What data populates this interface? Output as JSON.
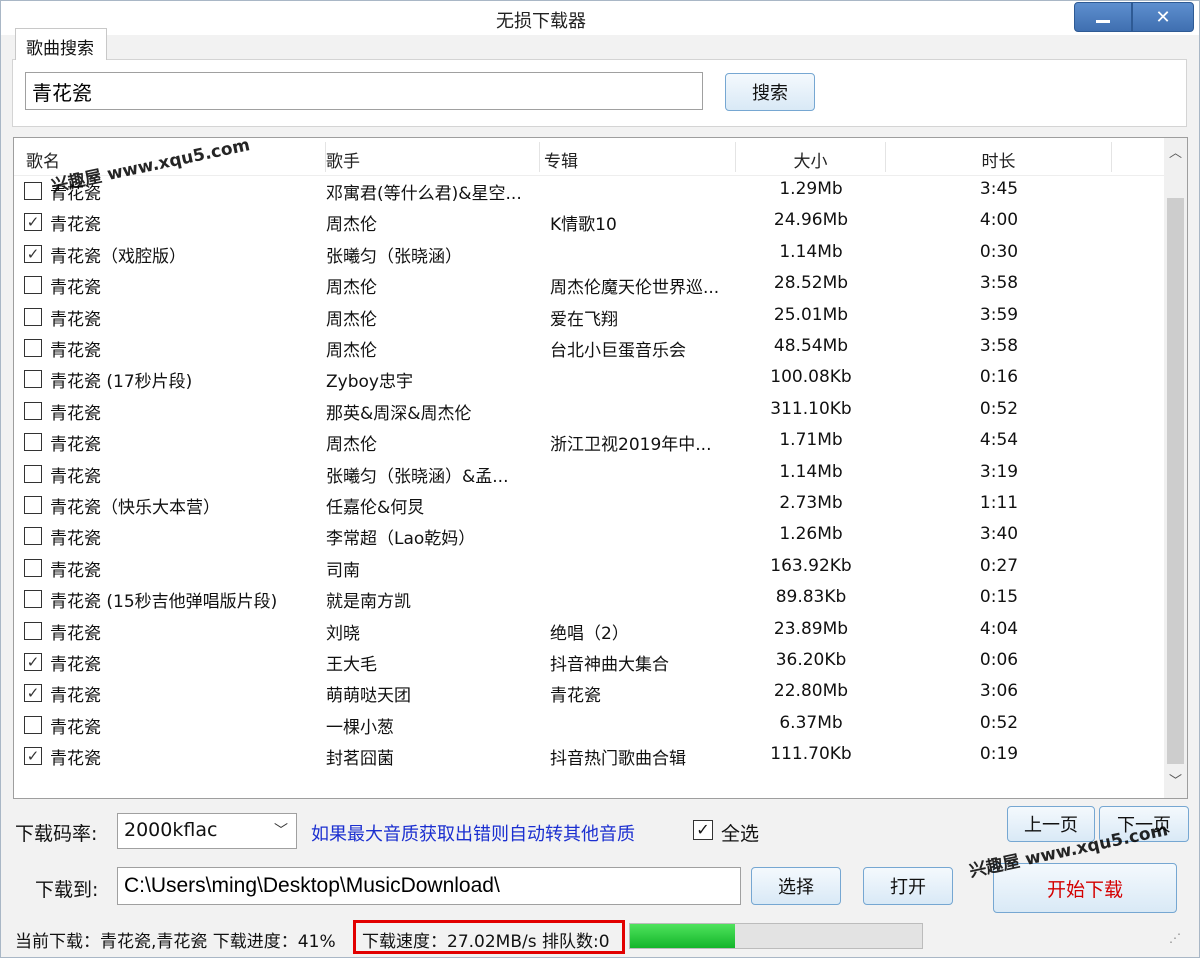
{
  "window": {
    "title": "无损下载器"
  },
  "tabs": [
    {
      "label": "歌曲搜索"
    }
  ],
  "search": {
    "value": "青花瓷",
    "button_label": "搜索"
  },
  "table": {
    "headers": [
      "歌名",
      "歌手",
      "专辑",
      "大小",
      "时长"
    ],
    "rows": [
      {
        "checked": false,
        "title": "青花瓷",
        "artist": "邓寓君(等什么君)&星空...",
        "album": "",
        "size": "1.29Mb",
        "duration": "3:45"
      },
      {
        "checked": true,
        "title": "青花瓷",
        "artist": "周杰伦",
        "album": "K情歌10",
        "size": "24.96Mb",
        "duration": "4:00"
      },
      {
        "checked": true,
        "title": "青花瓷（戏腔版）",
        "artist": "张曦匀（张晓涵）",
        "album": "",
        "size": "1.14Mb",
        "duration": "0:30"
      },
      {
        "checked": false,
        "title": "青花瓷",
        "artist": "周杰伦",
        "album": "周杰伦魔天伦世界巡...",
        "size": "28.52Mb",
        "duration": "3:58"
      },
      {
        "checked": false,
        "title": "青花瓷",
        "artist": "周杰伦",
        "album": "爱在飞翔",
        "size": "25.01Mb",
        "duration": "3:59"
      },
      {
        "checked": false,
        "title": "青花瓷",
        "artist": "周杰伦",
        "album": "台北小巨蛋音乐会",
        "size": "48.54Mb",
        "duration": "3:58"
      },
      {
        "checked": false,
        "title": "青花瓷 (17秒片段)",
        "artist": "Zyboy忠宇",
        "album": "",
        "size": "100.08Kb",
        "duration": "0:16"
      },
      {
        "checked": false,
        "title": "青花瓷",
        "artist": "那英&周深&周杰伦",
        "album": "",
        "size": "311.10Kb",
        "duration": "0:52"
      },
      {
        "checked": false,
        "title": "青花瓷",
        "artist": "周杰伦",
        "album": "浙江卫视2019年中...",
        "size": "1.71Mb",
        "duration": "4:54"
      },
      {
        "checked": false,
        "title": "青花瓷",
        "artist": "张曦匀（张晓涵）&孟...",
        "album": "",
        "size": "1.14Mb",
        "duration": "3:19"
      },
      {
        "checked": false,
        "title": "青花瓷（快乐大本营）",
        "artist": "任嘉伦&何炅",
        "album": "",
        "size": "2.73Mb",
        "duration": "1:11"
      },
      {
        "checked": false,
        "title": "青花瓷",
        "artist": "李常超（Lao乾妈）",
        "album": "",
        "size": "1.26Mb",
        "duration": "3:40"
      },
      {
        "checked": false,
        "title": "青花瓷",
        "artist": "司南",
        "album": "",
        "size": "163.92Kb",
        "duration": "0:27"
      },
      {
        "checked": false,
        "title": "青花瓷 (15秒吉他弹唱版片段)",
        "artist": "就是南方凯",
        "album": "",
        "size": "89.83Kb",
        "duration": "0:15"
      },
      {
        "checked": false,
        "title": "青花瓷",
        "artist": "刘晓",
        "album": "绝唱（2）",
        "size": "23.89Mb",
        "duration": "4:04"
      },
      {
        "checked": true,
        "title": "青花瓷",
        "artist": "王大毛",
        "album": "抖音神曲大集合",
        "size": "36.20Kb",
        "duration": "0:06"
      },
      {
        "checked": true,
        "title": "青花瓷",
        "artist": "萌萌哒天团",
        "album": "青花瓷",
        "size": "22.80Mb",
        "duration": "3:06"
      },
      {
        "checked": false,
        "title": "青花瓷",
        "artist": "一棵小葱",
        "album": "",
        "size": "6.37Mb",
        "duration": "0:52"
      },
      {
        "checked": true,
        "title": "青花瓷",
        "artist": "封茗囧菌",
        "album": "抖音热门歌曲合辑",
        "size": "111.70Kb",
        "duration": "0:19"
      }
    ]
  },
  "controls": {
    "bitrate_label": "下载码率:",
    "bitrate_value": "2000kflac",
    "hint": "如果最大音质获取出错则自动转其他音质",
    "select_all_label": "全选",
    "select_all_checked": true,
    "prev_page": "上一页",
    "next_page": "下一页",
    "download_to_label": "下载到:",
    "download_path": "C:\\Users\\ming\\Desktop\\MusicDownload\\",
    "choose_button": "选择",
    "open_button": "打开",
    "start_button": "开始下载"
  },
  "status": {
    "current": "当前下载：青花瓷,青花瓷 下载进度：41%",
    "speed": "下载速度：27.02MB/s 排队数:0",
    "progress_fraction": 0.36
  },
  "watermark": "兴趣屋 www.xqu5.com",
  "colors": {
    "accent": "#76a7d2",
    "start_text": "#d40000",
    "hint_text": "#1b2fd0",
    "highlight_border": "#e20000",
    "progress": "#13b52a"
  }
}
